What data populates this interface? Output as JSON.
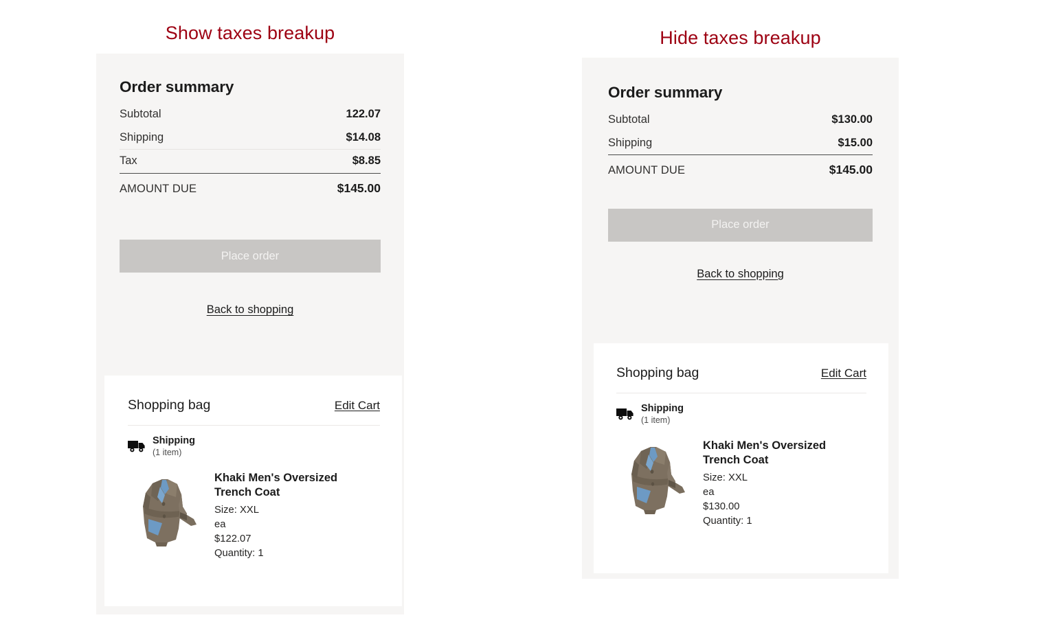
{
  "theme": {
    "title_color": "#9d0012",
    "panel_bg": "#f6f5f4",
    "card_bg": "#ffffff",
    "button_bg": "#c8c6c4",
    "button_text": "#f3f2f1",
    "text_color": "#1b1b1b",
    "rule_color": "#4a4a4a",
    "hairline_color": "#e6e4e2"
  },
  "panels": [
    {
      "id": "show-taxes",
      "title": "Show taxes breakup",
      "summary": {
        "heading": "Order summary",
        "rows": [
          {
            "label": "Subtotal",
            "value": "122.07"
          },
          {
            "label": "Shipping",
            "value": "$14.08"
          },
          {
            "label": "Tax",
            "value": "$8.85"
          }
        ],
        "total": {
          "label": "AMOUNT DUE",
          "value": "$145.00"
        }
      },
      "place_order_label": "Place order",
      "back_link_label": "Back to shopping",
      "bag": {
        "title": "Shopping bag",
        "edit_link_label": "Edit Cart",
        "shipping_label": "Shipping",
        "shipping_count": "(1 item)",
        "truck_icon": "delivery-truck-icon",
        "item": {
          "name": "Khaki Men's Oversized Trench Coat",
          "size": "Size: XXL",
          "unit": "ea",
          "price": "$122.07",
          "quantity": "Quantity: 1",
          "image": "khaki-trench-coat-thumbnail"
        }
      }
    },
    {
      "id": "hide-taxes",
      "title": "Hide taxes breakup",
      "summary": {
        "heading": "Order summary",
        "rows": [
          {
            "label": "Subtotal",
            "value": "$130.00"
          },
          {
            "label": "Shipping",
            "value": "$15.00"
          }
        ],
        "total": {
          "label": "AMOUNT DUE",
          "value": "$145.00"
        }
      },
      "place_order_label": "Place order",
      "back_link_label": "Back to shopping",
      "bag": {
        "title": "Shopping bag",
        "edit_link_label": "Edit Cart",
        "shipping_label": "Shipping",
        "shipping_count": "(1 item)",
        "truck_icon": "delivery-truck-icon",
        "item": {
          "name": "Khaki Men's Oversized Trench Coat",
          "size": "Size: XXL",
          "unit": "ea",
          "price": "$130.00",
          "quantity": "Quantity: 1",
          "image": "khaki-trench-coat-thumbnail"
        }
      }
    }
  ]
}
